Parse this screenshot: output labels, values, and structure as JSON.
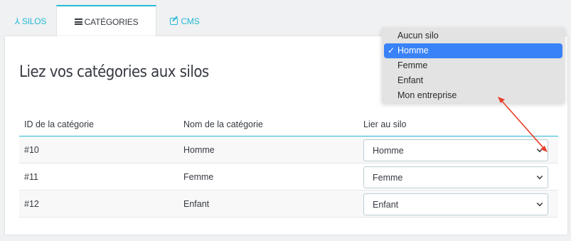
{
  "tabs": [
    {
      "label": "SILOS",
      "icon": "silo-icon"
    },
    {
      "label": "CATÉGORIES",
      "icon": "list-icon"
    },
    {
      "label": "CMS",
      "icon": "edit-icon"
    }
  ],
  "active_tab": "CATÉGORIES",
  "title": "Liez vos catégories aux silos",
  "table": {
    "headers": [
      "ID de la catégorie",
      "Nom de la catégorie",
      "Lier au silo"
    ],
    "rows": [
      {
        "id": "#10",
        "name": "Homme",
        "silo": "Homme"
      },
      {
        "id": "#11",
        "name": "Femme",
        "silo": "Femme"
      },
      {
        "id": "#12",
        "name": "Enfant",
        "silo": "Enfant"
      }
    ]
  },
  "dropdown": {
    "options": [
      "Aucun silo",
      "Homme",
      "Femme",
      "Enfant",
      "Mon entreprise"
    ],
    "selected": "Homme",
    "check_glyph": "✓"
  },
  "colors": {
    "accent": "#25b9d7",
    "selection": "#3a82f7",
    "annotation_arrow": "#e8402a"
  }
}
